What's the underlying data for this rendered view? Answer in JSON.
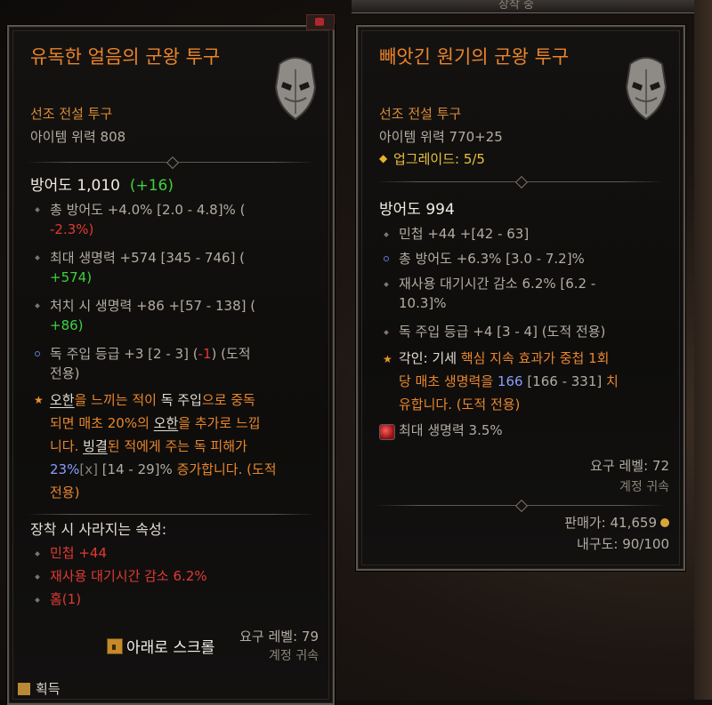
{
  "background": {
    "top_tab": "장착 중"
  },
  "left_item": {
    "name": "유독한 얼음의 군왕 투구",
    "rarity": "선조 전설 투구",
    "item_power": "아이템 위력 808",
    "armor_label": "방어도 1,010",
    "armor_delta": "(+16)",
    "stats": [
      {
        "text": "총 방어도 +4.0% [2.0 - 4.8]% (",
        "delta": "-2.3%)"
      },
      {
        "text": "최대 생명력 +574 [345 - 746] (",
        "delta": "+574)"
      },
      {
        "text": "처치 시 생명력 +86 +[57 - 138] (",
        "delta": "+86)"
      },
      {
        "text": "독 주입 등급 +3 [2 - 3] (",
        "delta": "-1",
        "suffix": ") (도적",
        "line2": "전용)"
      }
    ],
    "aspect": {
      "line1": [
        "오한",
        "을 느끼는 적이 ",
        "독 주입",
        "으로 중독"
      ],
      "line2": [
        "되면 매초 20%의 ",
        "오한",
        "을 추가로 느낍"
      ],
      "line3": [
        "니다. ",
        "빙결",
        "된 적에게 주는 독 피해가"
      ],
      "line4": [
        "23%",
        "[x]",
        " [14 - 29]%",
        " 증가합니다. (도적"
      ],
      "line5": "전용)"
    },
    "lost_header": "장착 시 사라지는 속성:",
    "lost_stats": [
      "민첩 +44",
      "재사용 대기시간 감소 6.2%",
      "홈(1)"
    ],
    "required_level": "요구 레벨: 79",
    "bound": "계정 귀속"
  },
  "right_item": {
    "name": "빼앗긴 원기의 군왕 투구",
    "rarity": "선조 전설 투구",
    "item_power": "아이템 위력 770+25",
    "upgrades": "업그레이드: 5/5",
    "armor_label": "방어도 994",
    "stats": [
      "민첩 +44 +[42 - 63]",
      "총 방어도 +6.3% [3.0 - 7.2]%",
      "재사용 대기시간 감소 6.2% [6.2 -",
      "10.3]%",
      "독 주입 등급 +4 [3 - 4] (도적 전용)"
    ],
    "aspect": {
      "line1": [
        "각인: ",
        "기세 ",
        "핵심 지속 효과가 중첩 1회"
      ],
      "line2": [
        "당 매초 생명력을 ",
        "166",
        " [166 - 331]",
        " 치"
      ],
      "line3": "유합니다. (도적 전용)"
    },
    "socket": "최대 생명력 3.5%",
    "required_level": "요구 레벨: 72",
    "bound": "계정 귀속",
    "sell_value": "판매가: 41,659",
    "durability": "내구도: 90/100"
  },
  "footer": {
    "scroll_hint": "아래로 스크롤",
    "acquire": "획득"
  },
  "colors": {
    "legendary": "#e8842c",
    "positive": "#3ed23e",
    "negative": "#e03a32",
    "aspect": "#e9862d",
    "border": "#5c554d"
  }
}
